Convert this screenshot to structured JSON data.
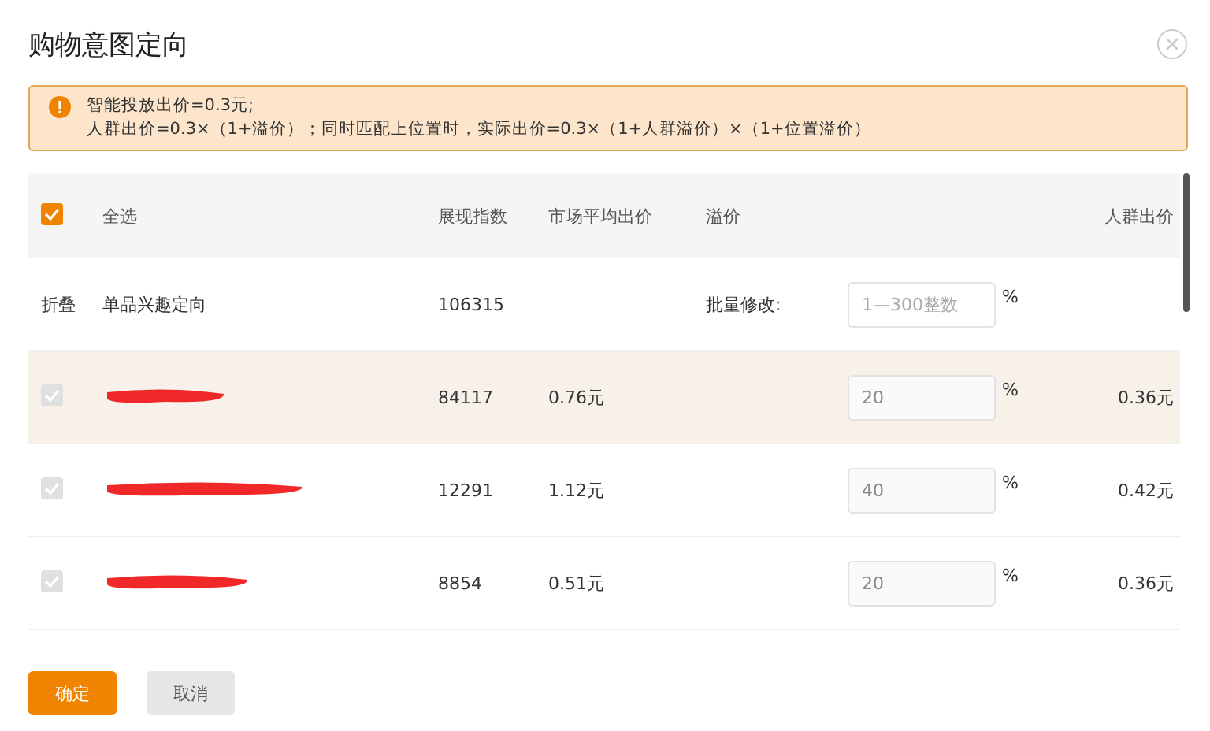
{
  "dialog": {
    "title": "购物意图定向"
  },
  "notice": {
    "lines": [
      "智能投放出价=0.3元;",
      "人群出价=0.3×（1+溢价）；同时匹配上位置时，实际出价=0.3×（1+人群溢价）×（1+位置溢价）"
    ]
  },
  "table": {
    "select_all": {
      "label": "全选",
      "checked": true
    },
    "columns": [
      "展现指数",
      "市场平均出价",
      "溢价",
      "人群出价"
    ],
    "group": {
      "toggle": "折叠",
      "name": "单品兴趣定向",
      "impressions": "106315",
      "batch_label": "批量修改:",
      "batch_placeholder": "1—300整数",
      "unit": "%"
    },
    "rows": [
      {
        "checked": true,
        "highlighted": true,
        "impressions": "84117",
        "avg_bid": "0.76元",
        "premium": "20",
        "unit": "%",
        "bid": "0.36元"
      },
      {
        "checked": true,
        "highlighted": false,
        "impressions": "12291",
        "avg_bid": "1.12元",
        "premium": "40",
        "unit": "%",
        "bid": "0.42元"
      },
      {
        "checked": true,
        "highlighted": false,
        "impressions": "8854",
        "avg_bid": "0.51元",
        "premium": "20",
        "unit": "%",
        "bid": "0.36元"
      }
    ]
  },
  "buttons": {
    "confirm": "确定",
    "cancel": "取消"
  }
}
